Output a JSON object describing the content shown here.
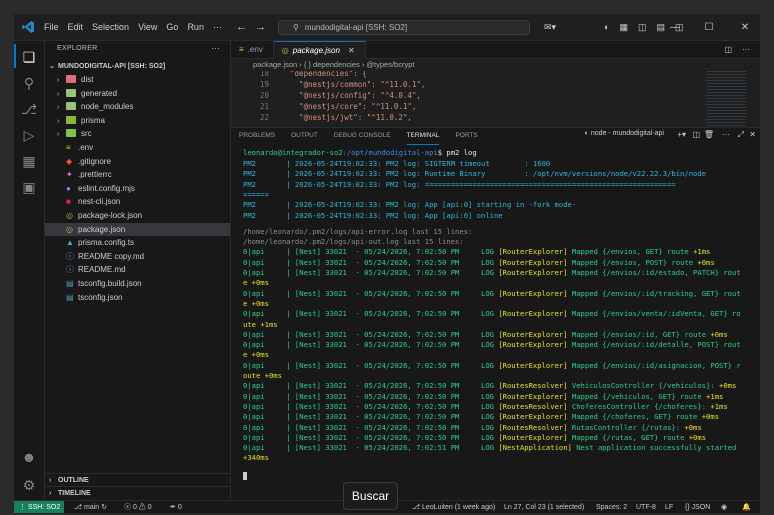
{
  "titlebar": {
    "menu": [
      "File",
      "Edit",
      "Selection",
      "View",
      "Go",
      "Run",
      "···"
    ],
    "command_center": "mundodigital-api [SSH: SO2]"
  },
  "sidebar": {
    "header": "EXPLORER",
    "root": "MUNDODIGITAL-API [SSH: SO2]",
    "folders": [
      {
        "name": "dist",
        "color": "#e06c75"
      },
      {
        "name": "generated",
        "color": "#98c379"
      },
      {
        "name": "node_modules",
        "color": "#98c379"
      },
      {
        "name": "prisma",
        "color": "#8bb83b"
      },
      {
        "name": "src",
        "color": "#7ec345"
      }
    ],
    "files": [
      {
        "name": ".env",
        "color": "#cbcb41",
        "glyph": "≡"
      },
      {
        "name": ".gitignore",
        "color": "#f05032",
        "glyph": "◆"
      },
      {
        "name": ".prettierrc",
        "color": "#c98bd8",
        "glyph": "✦"
      },
      {
        "name": "eslint.config.mjs",
        "color": "#7d87f5",
        "glyph": "●"
      },
      {
        "name": "nest-cli.json",
        "color": "#e0234e",
        "glyph": "■"
      },
      {
        "name": "package-lock.json",
        "color": "#8bc34a",
        "glyph": "◎"
      },
      {
        "name": "package.json",
        "color": "#8bc34a",
        "glyph": "◎"
      },
      {
        "name": "prisma.config.ts",
        "color": "#41b3d8",
        "glyph": "▲"
      },
      {
        "name": "README copy.md",
        "color": "#4fa3e0",
        "glyph": "ⓘ"
      },
      {
        "name": "README.md",
        "color": "#4fa3e0",
        "glyph": "ⓘ"
      },
      {
        "name": "tsconfig.build.json",
        "color": "#519aba",
        "glyph": "▤"
      },
      {
        "name": "tsconfig.json",
        "color": "#519aba",
        "glyph": "▤"
      }
    ],
    "outline": "OUTLINE",
    "timeline": "TIMELINE"
  },
  "editor": {
    "tabs": [
      {
        "label": ".env",
        "active": false
      },
      {
        "label": "package.json",
        "active": true
      }
    ],
    "breadcrumb": "package.json  ›  { } dependencies  ›  @types/bcrypt",
    "lines": [
      {
        "num": "18",
        "text": "  \"dependencies\": {"
      },
      {
        "num": "19",
        "text": "    \"@nestjs/common\": \"^11.0.1\","
      },
      {
        "num": "20",
        "text": "    \"@nestjs/config\": \"^4.0.4\","
      },
      {
        "num": "21",
        "text": "    \"@nestjs/core\": \"^11.0.1\","
      },
      {
        "num": "22",
        "text": "    \"@nestjs/jwt\": \"^11.0.2\","
      }
    ]
  },
  "panel": {
    "tabs": [
      "PROBLEMS",
      "OUTPUT",
      "DEBUG CONSOLE",
      "TERMINAL",
      "PORTS"
    ],
    "terminal_name": "node - mundodigital-api",
    "prompt_user": "leonardo@integrador-so2",
    "prompt_path": ":/opt/mundodigital-api",
    "prompt_cmd": "$ pm2 log",
    "pm2_lines": [
      "PM2       | 2026-05-24T19:02:33: PM2 log: SIGTERM timeout        : 1600",
      "PM2       | 2026-05-24T19:02:33: PM2 log: Runtime Binary         : /opt/nvm/versions/node/v22.22.3/bin/node",
      "PM2       | 2026-05-24T19:02:33: PM2 log: ==========================================================",
      "======",
      "PM2       | 2026-05-24T19:02:33: PM2 log: App [api:0] starting in -fork mode-",
      "PM2       | 2026-05-24T19:02:33: PM2 log: App [api:0] online"
    ],
    "log_headers": [
      "/home/leonardo/.pm2/logs/api-error.log last 15 lines:",
      "/home/leonardo/.pm2/logs/api-out.log last 15 lines:"
    ],
    "log_lines": [
      {
        "ctx": "[RouterExplorer]",
        "msg": "Mapped {/envios, GET} route",
        "time": "+1ms",
        "wrap": ""
      },
      {
        "ctx": "[RouterExplorer]",
        "msg": "Mapped {/envios, POST} route",
        "time": "+0ms",
        "wrap": ""
      },
      {
        "ctx": "[RouterExplorer]",
        "msg": "Mapped {/envios/:id/estado, PATCH} rout",
        "time": "",
        "wrap": "e +0ms"
      },
      {
        "ctx": "[RouterExplorer]",
        "msg": "Mapped {/envios/:id/tracking, GET} rout",
        "time": "",
        "wrap": "e +0ms"
      },
      {
        "ctx": "[RouterExplorer]",
        "msg": "Mapped {/envios/venta/:idVenta, GET} ro",
        "time": "",
        "wrap": "ute +1ms"
      },
      {
        "ctx": "[RouterExplorer]",
        "msg": "Mapped {/envios/:id, GET} route",
        "time": "+0ms",
        "wrap": ""
      },
      {
        "ctx": "[RouterExplorer]",
        "msg": "Mapped {/envios/:id/detalle, POST} rout",
        "time": "",
        "wrap": "e +0ms"
      },
      {
        "ctx": "[RouterExplorer]",
        "msg": "Mapped {/envios/:id/asignacion, POST} r",
        "time": "",
        "wrap": "oute +0ms"
      },
      {
        "ctx": "[RoutesResolver]",
        "msg": "VehiculosController {/vehiculos}:",
        "time": "+0ms",
        "wrap": ""
      },
      {
        "ctx": "[RouterExplorer]",
        "msg": "Mapped {/vehiculos, GET} route",
        "time": "+1ms",
        "wrap": ""
      },
      {
        "ctx": "[RoutesResolver]",
        "msg": "ChoferesController {/choferes}:",
        "time": "+1ms",
        "wrap": ""
      },
      {
        "ctx": "[RouterExplorer]",
        "msg": "Mapped {/choferes, GET} route",
        "time": "+0ms",
        "wrap": ""
      },
      {
        "ctx": "[RoutesResolver]",
        "msg": "RutasController {/rutas}:",
        "time": "+0ms",
        "wrap": ""
      },
      {
        "ctx": "[RouterExplorer]",
        "msg": "Mapped {/rutas, GET} route",
        "time": "+0ms",
        "wrap": ""
      },
      {
        "ctx": "[NestApplication]",
        "msg": "Nest application successfully started",
        "time": "",
        "wrap": "+340ms"
      }
    ],
    "log_prefix": "0|api     | [Nest] 33021  - 05/24/2026, 7:02:50 PM     LOG ",
    "log_prefix_last": "0|api     | [Nest] 33021  - 05/24/2026, 7:02:51 PM     LOG "
  },
  "statusbar": {
    "remote": "SSH: SO2",
    "branch": "main",
    "problems": "ⓧ 0 ⚠ 0",
    "ports": "0",
    "blame": "LeoLuiten (1 week ago)",
    "position": "Ln 27, Col 23 (1 selected)",
    "spaces": "Spaces: 2",
    "encoding": "UTF-8",
    "eol": "LF",
    "language": "{} JSON"
  },
  "tooltip": "Buscar"
}
